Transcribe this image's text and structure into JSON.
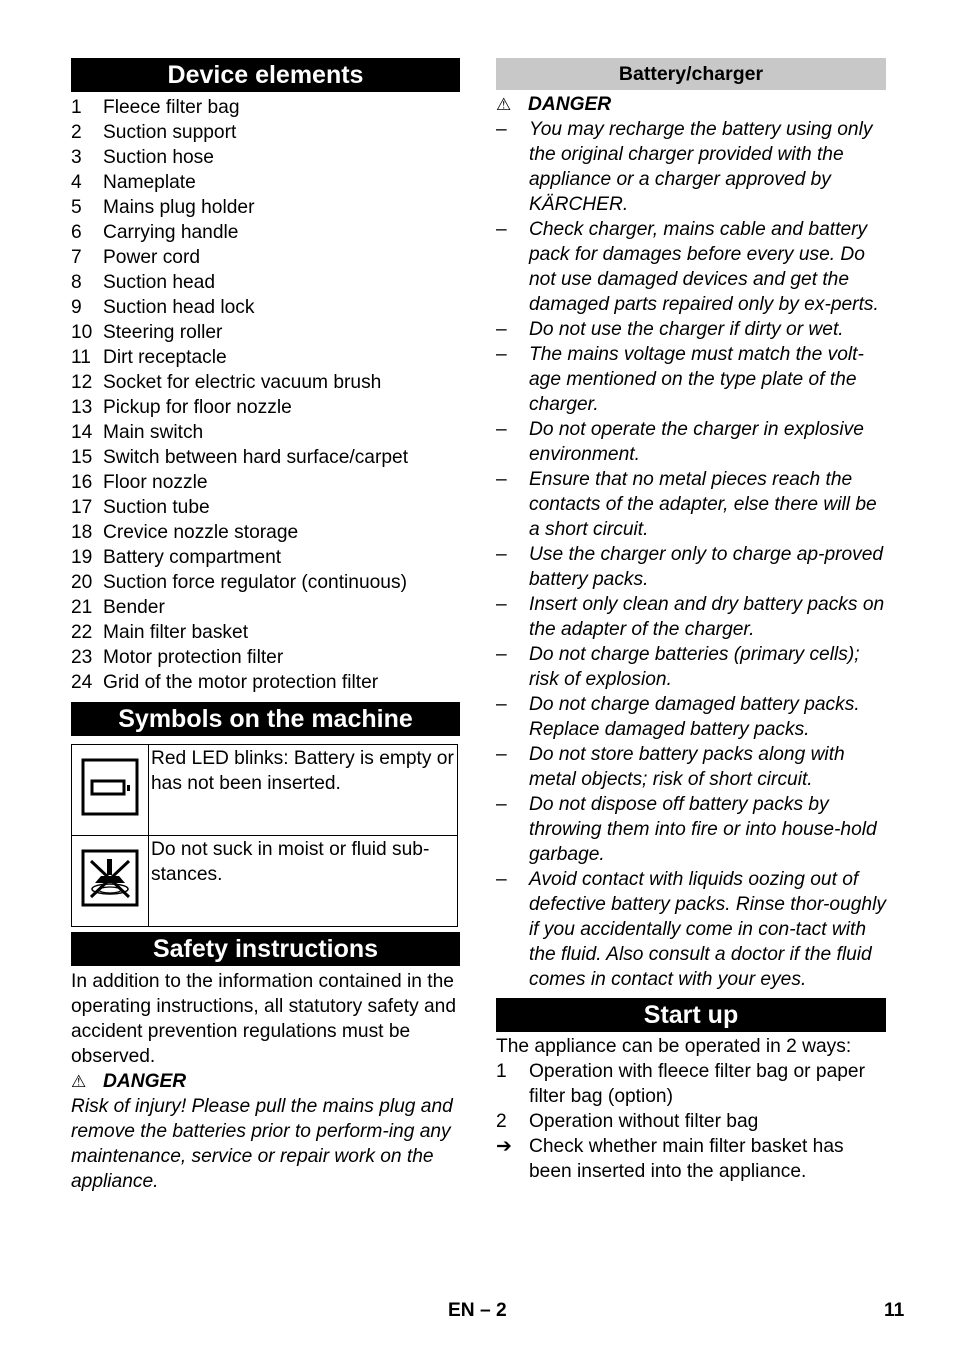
{
  "left": {
    "device_elements": {
      "title": "Device elements",
      "items": [
        {
          "num": "1",
          "label": "Fleece filter bag"
        },
        {
          "num": "2",
          "label": "Suction support"
        },
        {
          "num": "3",
          "label": "Suction hose"
        },
        {
          "num": "4",
          "label": "Nameplate"
        },
        {
          "num": "5",
          "label": "Mains plug holder"
        },
        {
          "num": "6",
          "label": "Carrying handle"
        },
        {
          "num": "7",
          "label": "Power cord"
        },
        {
          "num": "8",
          "label": "Suction head"
        },
        {
          "num": "9",
          "label": "Suction head lock"
        },
        {
          "num": "10",
          "label": "Steering roller"
        },
        {
          "num": "11",
          "label": "Dirt receptacle"
        },
        {
          "num": "12",
          "label": "Socket for electric vacuum brush"
        },
        {
          "num": "13",
          "label": "Pickup for floor nozzle"
        },
        {
          "num": "14",
          "label": "Main switch"
        },
        {
          "num": "15",
          "label": "Switch between hard surface/carpet"
        },
        {
          "num": "16",
          "label": "Floor nozzle"
        },
        {
          "num": "17",
          "label": "Suction tube"
        },
        {
          "num": "18",
          "label": "Crevice nozzle storage"
        },
        {
          "num": "19",
          "label": "Battery compartment"
        },
        {
          "num": "20",
          "label": "Suction force regulator (continuous)"
        },
        {
          "num": "21",
          "label": "Bender"
        },
        {
          "num": "22",
          "label": "Main filter basket"
        },
        {
          "num": "23",
          "label": "Motor protection filter"
        },
        {
          "num": "24",
          "label": "Grid of the motor protection filter"
        }
      ]
    },
    "symbols": {
      "title": "Symbols on the machine",
      "rows": [
        {
          "icon": "battery-empty-icon",
          "text": "Red LED blinks: Battery is empty or has not been inserted."
        },
        {
          "icon": "no-liquid-suction-icon",
          "text": "Do not suck in moist or fluid sub-stances."
        }
      ]
    },
    "safety": {
      "title": "Safety instructions",
      "intro": "In addition to the information contained in the operating instructions, all statutory safety and accident prevention regulations must be observed.",
      "danger_symbol": "⚠",
      "danger_label": "DANGER",
      "danger_text": "Risk of injury! Please pull the mains plug and remove the batteries prior to perform-ing any maintenance, service or repair work on the appliance."
    }
  },
  "right": {
    "battery": {
      "title": "Battery/charger",
      "danger_symbol": "⚠",
      "danger_label": "DANGER",
      "dash": "–",
      "items": [
        "You may recharge the battery using only the original charger provided with the appliance or a charger approved by KÄRCHER.",
        "Check charger, mains cable and battery pack for damages before every use. Do not use damaged devices and get the damaged parts repaired only by ex-perts.",
        "Do not use the charger if dirty or wet.",
        "The mains voltage must match the volt-age mentioned on the type plate of the charger.",
        "Do not operate the charger in explosive environment.",
        "Ensure that no metal pieces reach the contacts of the adapter, else there will be a short circuit.",
        "Use the charger only to charge ap-proved battery packs.",
        "Insert only clean and dry battery packs on the adapter of the charger.",
        "Do not charge batteries (primary cells); risk of explosion.",
        "Do not charge damaged battery packs. Replace damaged battery packs.",
        "Do not store battery packs along with metal objects; risk of short circuit.",
        "Do not dispose off battery packs by throwing them into fire or into house-hold garbage.",
        "Avoid contact with liquids oozing out of defective battery packs. Rinse thor-oughly if you accidentally come in con-tact with the fluid. Also consult a doctor if the fluid comes in contact with your eyes."
      ]
    },
    "startup": {
      "title": "Start up",
      "intro": "The appliance can be operated in 2 ways:",
      "items": [
        {
          "marker": "1",
          "text": "Operation with fleece filter bag or paper filter bag (option)"
        },
        {
          "marker": "2",
          "text": "Operation without filter bag"
        },
        {
          "marker": "➔",
          "text": "Check whether main filter basket has been inserted into the appliance."
        }
      ]
    }
  },
  "footer": {
    "lang_page": "EN – 2",
    "page_number": "11"
  }
}
